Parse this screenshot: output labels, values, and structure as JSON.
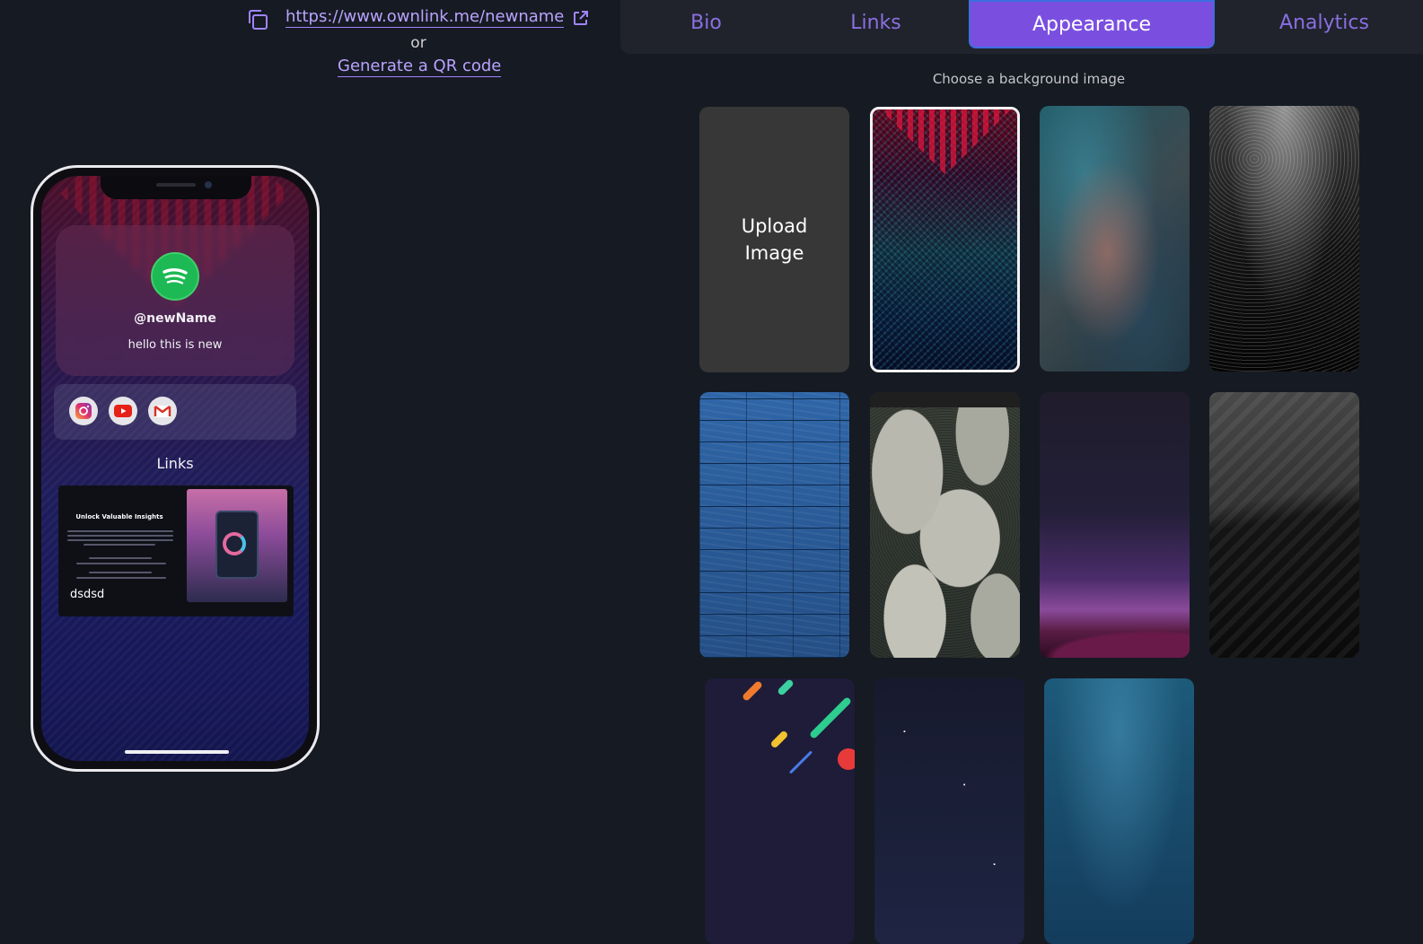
{
  "share": {
    "url": "https://www.ownlink.me/newname",
    "or_text": "or",
    "qr_label": "Generate a QR code"
  },
  "preview": {
    "handle": "@newName",
    "bio": "hello this is new",
    "socials": [
      "instagram-icon",
      "youtube-icon",
      "gmail-icon"
    ],
    "links_heading": "Links",
    "link_card": {
      "title": "Unlock Valuable Insights",
      "caption": "dsdsd"
    }
  },
  "tabs": [
    {
      "label": "Bio"
    },
    {
      "label": "Links"
    },
    {
      "label": "Appearance",
      "active": true
    },
    {
      "label": "Analytics"
    }
  ],
  "appearance": {
    "background_label": "Choose a background image",
    "upload_label": "Upload\nImage",
    "selected_index": 1,
    "accent_color": "#7a4fe0",
    "link_color": "#b9a3ff"
  }
}
